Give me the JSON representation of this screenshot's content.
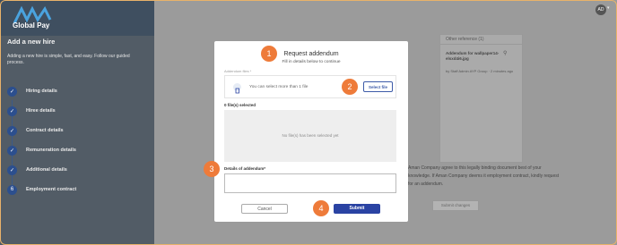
{
  "brand": {
    "name": "Global Pay"
  },
  "header": {
    "avatar_initials": "AD"
  },
  "sidebar": {
    "title": "Add a new hire",
    "subtitle": "Adding a new hire is simple, fast, and easy. Follow our guided process.",
    "steps": [
      {
        "label": "Hiring details",
        "state": "done"
      },
      {
        "label": "Hiree details",
        "state": "done"
      },
      {
        "label": "Contract details",
        "state": "done"
      },
      {
        "label": "Remuneration details",
        "state": "done"
      },
      {
        "label": "Additional details",
        "state": "done"
      },
      {
        "label": "Employment contract",
        "state": "current",
        "number": "6"
      }
    ]
  },
  "background": {
    "other_reference_title": "Other reference (1)",
    "ref_file_name": "Addendum for wallpaper14-elsxd4i6.jpg",
    "ref_file_meta": "by Staff Admin AYP Group · 2 minutes ago",
    "agreement_text": "Aman Company agree to this legally binding document best of your knowledge. If Aman Company deems it employment contract, kindly request for an addendum.",
    "bg_button": "Submit changes"
  },
  "modal": {
    "title": "Request addendum",
    "subtitle": "Fill in details below to continue",
    "files_label": "Addendum files *",
    "drop_hint": "You can select more than 1 file",
    "select_button": "Select file",
    "file_count": "0 file(s) selected",
    "empty_text": "No file(s) has been selected yet",
    "details_label": "Details of addendum*",
    "details_value": "",
    "cancel_button": "Cancel",
    "submit_button": "Submit"
  },
  "callouts": [
    "1",
    "2",
    "3",
    "4"
  ],
  "colors": {
    "accent": "#2a43a3",
    "callout": "#ee7b3a",
    "sidebar": "#525c66"
  }
}
